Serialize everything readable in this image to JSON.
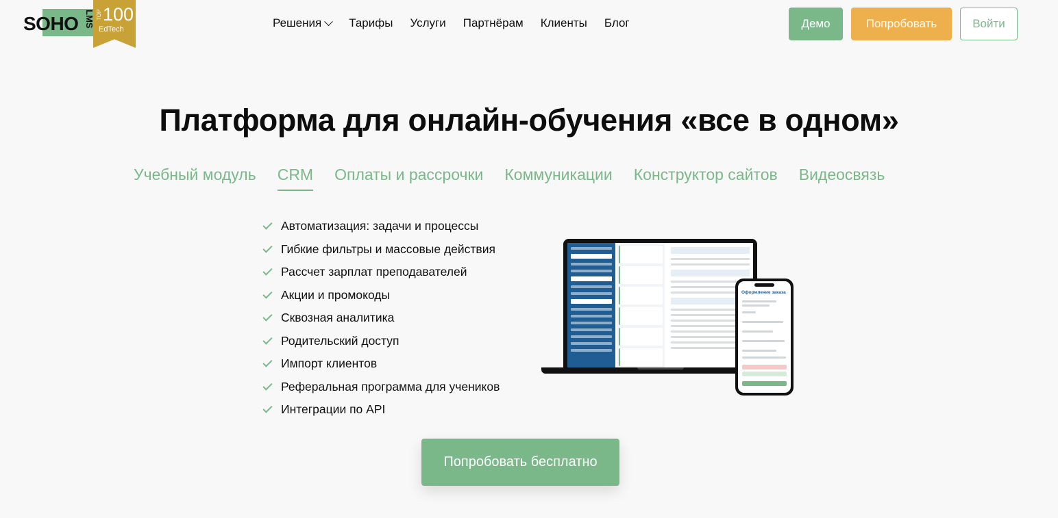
{
  "header": {
    "logo": {
      "brand": "SOHO",
      "product": "LMS",
      "badge_top": "TOP",
      "badge_number": "100",
      "badge_label": "EdTech"
    },
    "nav": [
      {
        "label": "Решения",
        "has_dropdown": true
      },
      {
        "label": "Тарифы"
      },
      {
        "label": "Услуги"
      },
      {
        "label": "Партнёрам"
      },
      {
        "label": "Клиенты"
      },
      {
        "label": "Блог"
      }
    ],
    "buttons": {
      "demo": "Демо",
      "try": "Попробовать",
      "login": "Войти"
    }
  },
  "hero": {
    "title": "Платформа для онлайн-обучения «все в одном»",
    "tabs": [
      {
        "label": "Учебный модуль",
        "active": false
      },
      {
        "label": "CRM",
        "active": true
      },
      {
        "label": "Оплаты и рассрочки",
        "active": false
      },
      {
        "label": "Коммуникации",
        "active": false
      },
      {
        "label": "Конструктор сайтов",
        "active": false
      },
      {
        "label": "Видеосвязь",
        "active": false
      }
    ],
    "features": [
      "Автоматизация: задачи и процессы",
      "Гибкие фильтры и массовые действия",
      "Рассчет зарплат преподавателей",
      "Акции и промокоды",
      "Сквозная аналитика",
      "Родительский доступ",
      "Импорт клиентов",
      "Реферальная программа для учеников",
      "Интеграции по API"
    ],
    "mockup": {
      "phone_title": "Оформление заказа"
    },
    "cta": "Попробовать бесплатно"
  },
  "colors": {
    "accent_green": "#7ab88a",
    "accent_orange": "#eeb04c",
    "badge_gold": "#c9a237",
    "screen_blue": "#1f5d92"
  }
}
